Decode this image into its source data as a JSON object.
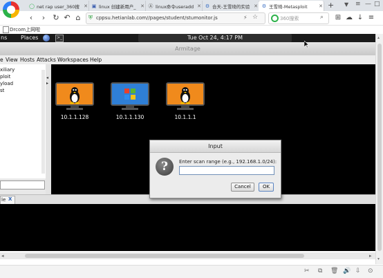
{
  "browser": {
    "tabs": [
      {
        "label": "net rap user_360搜",
        "icon": "360-search-icon"
      },
      {
        "label": "linux 创建新用户_",
        "icon": "page-icon"
      },
      {
        "label": "linux命令useradd",
        "icon": "page-icon"
      },
      {
        "label": "合天-王雪琦的实验",
        "icon": "hetian-icon"
      },
      {
        "label": "王雪琦-Metasploit",
        "icon": "hetian-icon"
      }
    ],
    "new_tab": "+",
    "url": "cppsu.hetianlab.com//pages/student/stumonitor.js",
    "search_placeholder": "360搜索",
    "bookmark": "Drcom上网啦"
  },
  "desktop": {
    "topbar_left": "ns",
    "topbar_places": "Places",
    "clock": "Tue Oct 24, 4:17 PM"
  },
  "armitage": {
    "window_title": "Armitage",
    "menu": [
      "e",
      "View",
      "Hosts",
      "Attacks",
      "Workspaces",
      "Help"
    ],
    "tree": [
      "xiliary",
      "ploit",
      "yload",
      "st"
    ],
    "hosts": [
      {
        "ip": "10.1.1.128",
        "os": "linux"
      },
      {
        "ip": "10.1.1.130",
        "os": "windows"
      },
      {
        "ip": "10.1.1.1",
        "os": "linux"
      }
    ],
    "console_tab": "le",
    "console_tab_close": "X"
  },
  "dialog": {
    "title": "Input",
    "prompt": "Enter scan range (e.g., 192.168.1.0/24):",
    "value": "",
    "cancel_label": "Cancel",
    "ok_label": "OK"
  },
  "colors": {
    "graph_bg": "#000000",
    "linux_screen": "#f08a1c",
    "windows_screen": "#2f7fd6"
  }
}
